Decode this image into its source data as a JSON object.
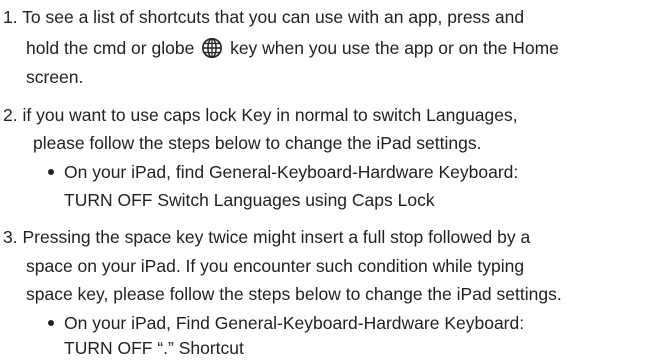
{
  "items": [
    {
      "number": "1.",
      "lines": [
        "To see a list of shortcuts that you can use with an app, press and",
        "hold the cmd or globe",
        "key when you use the app or on the Home",
        "screen."
      ]
    },
    {
      "number": "2.",
      "lines": [
        "if you want to use caps lock Key in normal to switch Languages,",
        "please follow the steps below to change the iPad settings."
      ],
      "bullet": [
        "On your iPad, find General-Keyboard-Hardware Keyboard:",
        "TURN OFF Switch Languages using Caps Lock"
      ]
    },
    {
      "number": "3.",
      "lines": [
        "Pressing the space key twice might insert a full stop followed by a",
        "space on your iPad. If you encounter such condition while typing",
        "space key, please follow the steps below to change the iPad settings."
      ],
      "bullet": [
        "On your iPad, Find General-Keyboard-Hardware Keyboard:",
        "TURN OFF “.” Shortcut"
      ]
    }
  ],
  "icons": {
    "globe": "globe-icon"
  }
}
